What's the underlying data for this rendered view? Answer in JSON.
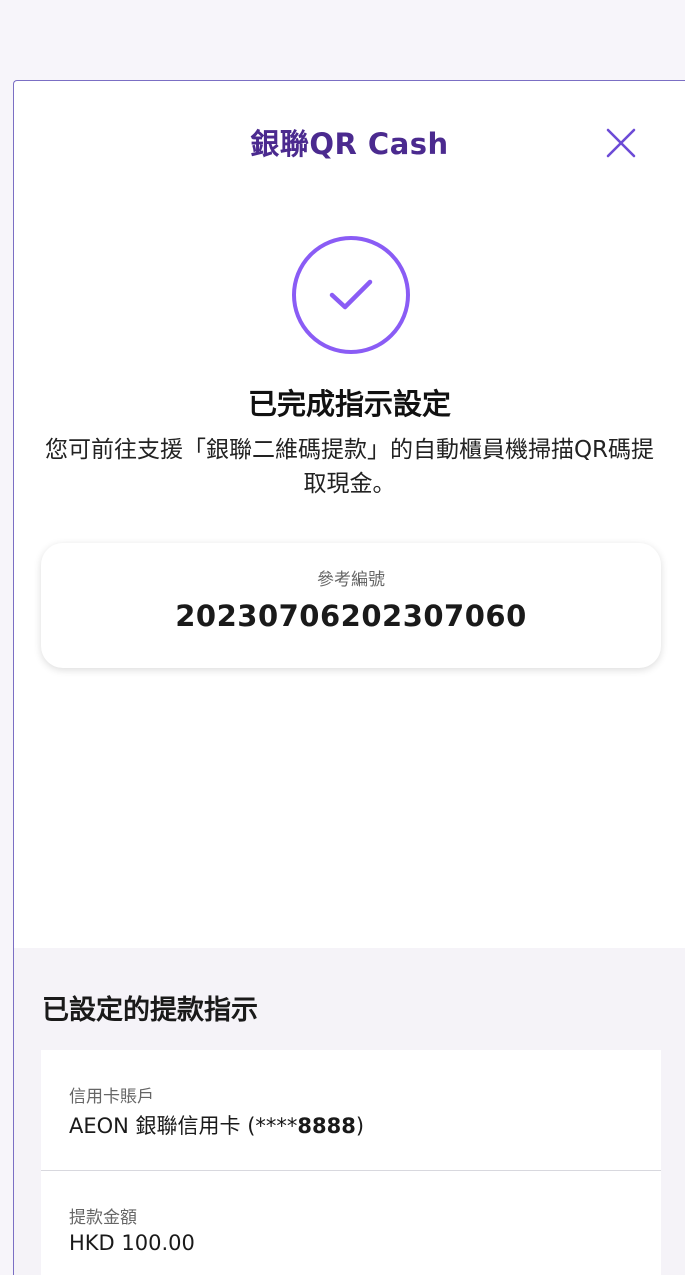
{
  "header": {
    "title": "銀聯QR Cash",
    "close_icon": "close-icon",
    "title_color": "#4b2a8f"
  },
  "success": {
    "icon": "check-circle-icon",
    "icon_color": "#8a5cf5",
    "title": "已完成指示設定",
    "description": "您可前往支援「銀聯二維碼提款」的自動櫃員機掃描QR碼提取現金。"
  },
  "reference": {
    "label": "參考編號",
    "value": "20230706202307060"
  },
  "instructions": {
    "title": "已設定的提款指示",
    "account": {
      "label": "信用卡賬戶",
      "value_prefix": "AEON 銀聯信用卡 (",
      "value_mask": "****",
      "value_digits": "8888",
      "value_suffix": ")"
    },
    "amount": {
      "label": "提款金額",
      "value": "HKD 100.00"
    }
  }
}
